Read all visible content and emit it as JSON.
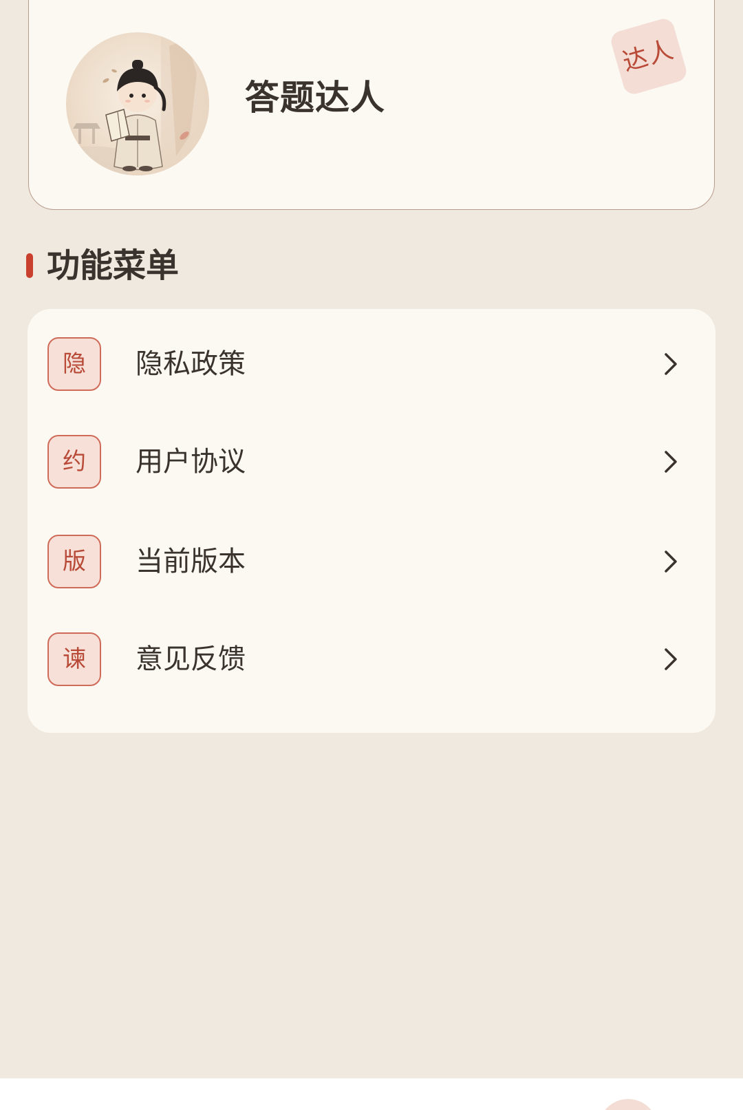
{
  "profile": {
    "name": "答题达人",
    "badge": "达人"
  },
  "section": {
    "title": "功能菜单"
  },
  "menu": {
    "items": [
      {
        "icon_char": "隐",
        "label": "隐私政策"
      },
      {
        "icon_char": "约",
        "label": "用户协议"
      },
      {
        "icon_char": "版",
        "label": "当前版本"
      },
      {
        "icon_char": "谏",
        "label": "意见反馈"
      }
    ]
  },
  "colors": {
    "background": "#efe9df",
    "card": "#fbf9f2",
    "accent": "#c9402f",
    "icon_bg": "#f6e0d8",
    "text": "#3a322d"
  }
}
